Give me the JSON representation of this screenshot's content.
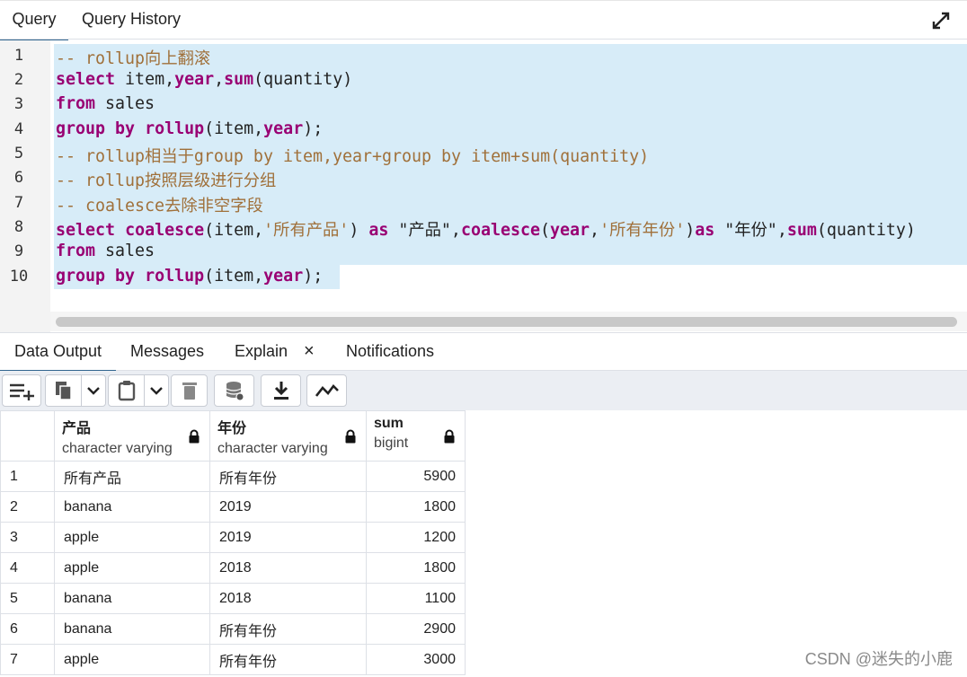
{
  "tabs": {
    "query": "Query",
    "history": "Query History"
  },
  "editor": {
    "line_numbers": [
      "1",
      "2",
      "3",
      "4",
      "5",
      "6",
      "7",
      "8",
      "9",
      "10"
    ]
  },
  "output_tabs": {
    "data_output": "Data Output",
    "messages": "Messages",
    "explain": "Explain",
    "explain_close": "×",
    "notifications": "Notifications"
  },
  "toolbar": {
    "icons": [
      "add-row-icon",
      "copy-icon",
      "chevron-down-icon",
      "paste-icon",
      "chevron-down-icon",
      "delete-icon",
      "save-data-icon",
      "download-icon",
      "graph-icon"
    ]
  },
  "grid": {
    "columns": [
      {
        "name": "产品",
        "type": "character varying"
      },
      {
        "name": "年份",
        "type": "character varying"
      },
      {
        "name": "sum",
        "type": "bigint"
      }
    ],
    "rows": [
      {
        "n": "1",
        "c1": "所有产品",
        "c2": "所有年份",
        "c3": "5900"
      },
      {
        "n": "2",
        "c1": "banana",
        "c2": "2019",
        "c3": "1800"
      },
      {
        "n": "3",
        "c1": "apple",
        "c2": "2019",
        "c3": "1200"
      },
      {
        "n": "4",
        "c1": "apple",
        "c2": "2018",
        "c3": "1800"
      },
      {
        "n": "5",
        "c1": "banana",
        "c2": "2018",
        "c3": "1100"
      },
      {
        "n": "6",
        "c1": "banana",
        "c2": "所有年份",
        "c3": "2900"
      },
      {
        "n": "7",
        "c1": "apple",
        "c2": "所有年份",
        "c3": "3000"
      }
    ]
  },
  "watermark": "CSDN @迷失的小鹿",
  "code": {
    "l1": {
      "a": "-- rollup向上翻滚"
    },
    "l2": {
      "a": "select",
      "b": " item,",
      "c": "year",
      "d": ",",
      "e": "sum",
      "f": "(quantity)"
    },
    "l3": {
      "a": "from",
      "b": " sales"
    },
    "l4": {
      "a": "group by",
      "b": " ",
      "c": "rollup",
      "d": "(item,",
      "e": "year",
      "f": ");"
    },
    "l5": {
      "a": "-- rollup相当于group by item,year+group by item+sum(quantity)"
    },
    "l6": {
      "a": "-- rollup按照层级进行分组"
    },
    "l7": {
      "a": "-- coalesce去除非空字段"
    },
    "l8": {
      "a": "select",
      "b": " ",
      "c": "coalesce",
      "d": "(item,",
      "e": "'所有产品'",
      "f": ") ",
      "g": "as",
      "h": " \"产品\",",
      "i": "coalesce",
      "j": "(",
      "k": "year",
      "l": ",",
      "m": "'所有年份'",
      "n": ")",
      "o": "as",
      "p": " \"年份\",",
      "q": "sum",
      "r": "(quantity)"
    },
    "l9": {
      "a": "from",
      "b": " sales"
    },
    "l10": {
      "a": "group by",
      "b": " ",
      "c": "rollup",
      "d": "(item,",
      "e": "year",
      "f": ");"
    }
  }
}
